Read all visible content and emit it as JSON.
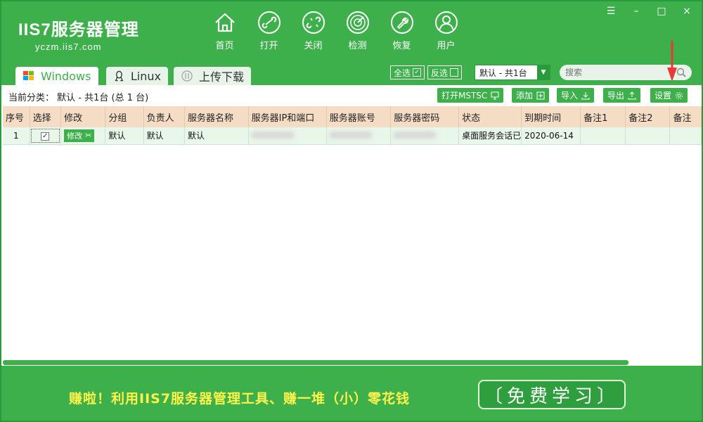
{
  "app": {
    "logo_title": "IIS7服务器管理",
    "logo_sub": "yczm.iis7.com"
  },
  "nav": [
    {
      "label": "首页",
      "icon": "home-icon"
    },
    {
      "label": "打开",
      "icon": "link-icon"
    },
    {
      "label": "关闭",
      "icon": "unlink-icon"
    },
    {
      "label": "检测",
      "icon": "radar-icon"
    },
    {
      "label": "恢复",
      "icon": "wrench-icon"
    },
    {
      "label": "用户",
      "icon": "user-icon"
    }
  ],
  "window_controls": {
    "menu": "☰",
    "minimize": "–",
    "maximize": "□",
    "close": "×"
  },
  "tabs": [
    {
      "label": "Windows",
      "icon": "windows-icon"
    },
    {
      "label": "Linux",
      "icon": "linux-icon"
    },
    {
      "label": "上传下载",
      "icon": "upload-icon"
    }
  ],
  "selection": {
    "select_all": "全选",
    "invert": "反选"
  },
  "group_dropdown": {
    "value": "默认 - 共1台"
  },
  "search": {
    "placeholder": "搜索"
  },
  "toolbar": {
    "category": "当前分类： 默认 - 共1台 (总 1 台)",
    "open_mstsc": "打开MSTSC",
    "add": "添加",
    "import": "导入",
    "export": "导出",
    "settings": "设置"
  },
  "table": {
    "headers": [
      "序号",
      "选择",
      "修改",
      "分组",
      "负责人",
      "服务器名称",
      "服务器IP和端口",
      "服务器账号",
      "服务器密码",
      "状态",
      "到期时间",
      "备注1",
      "备注2",
      "备注"
    ],
    "rows": [
      {
        "index": "1",
        "checked": "✓",
        "edit": "修改",
        "group": "默认",
        "owner": "默认",
        "name": "默认",
        "status": "桌面服务会话已",
        "expiry": "2020-06-14"
      }
    ]
  },
  "banner": {
    "text_a": "赚啦！利用IIS7服务器管理工具、赚一堆（小）",
    "text_b": "零花钱",
    "button": "〔免费学习〕"
  },
  "colors": {
    "brand": "#3daf4b",
    "header_row": "#f5dcc4",
    "accent_yellow": "#fff34a",
    "arrow": "#e83a3a"
  }
}
